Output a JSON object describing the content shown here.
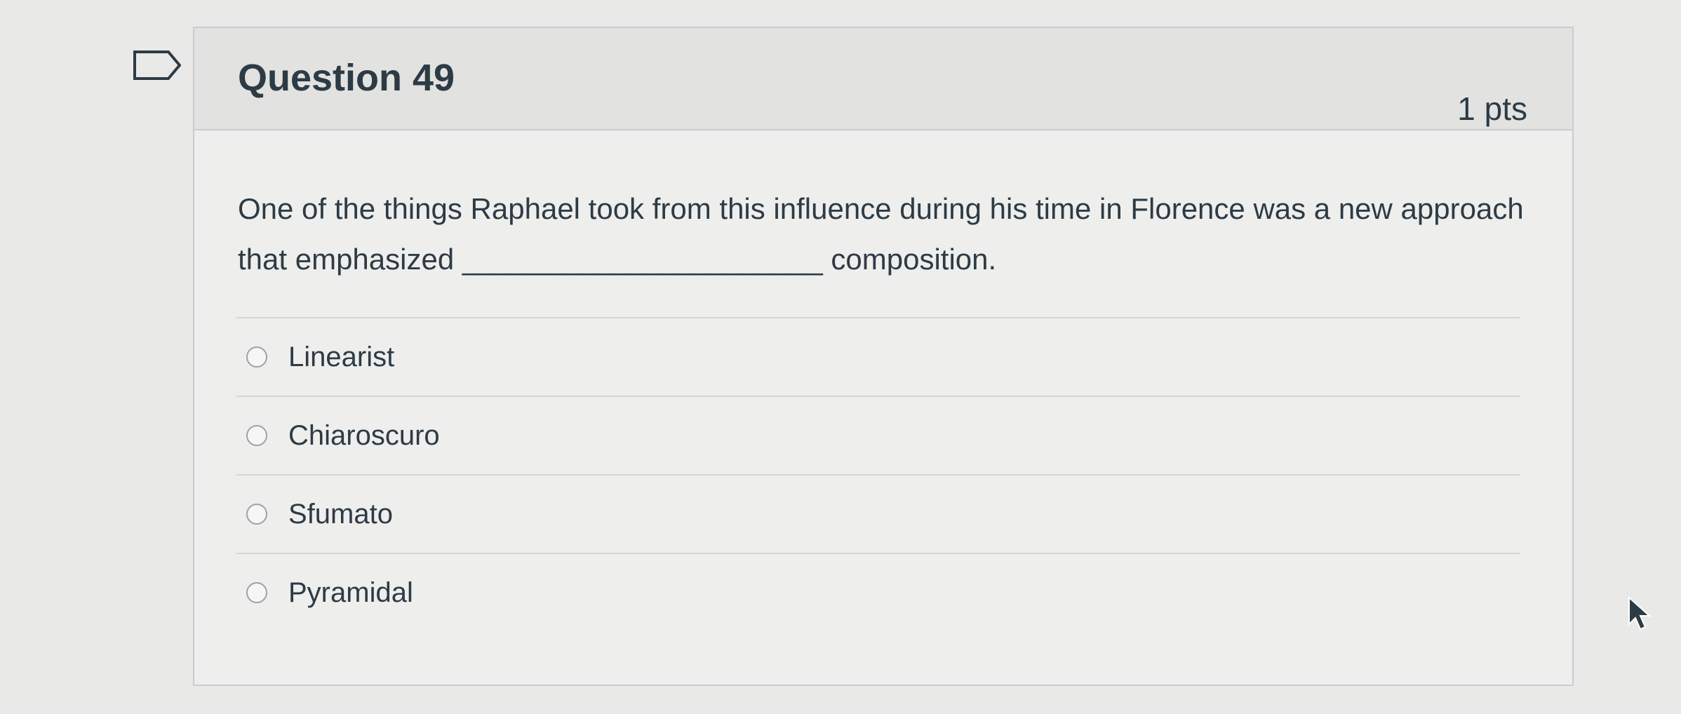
{
  "question": {
    "title": "Question 49",
    "points": "1 pts",
    "text": "One of the things Raphael took from this influence during his time in Florence was a new approach that emphasized ______________________ composition.",
    "answers": [
      {
        "label": "Linearist",
        "selected": false
      },
      {
        "label": "Chiaroscuro",
        "selected": false
      },
      {
        "label": "Sfumato",
        "selected": false
      },
      {
        "label": "Pyramidal",
        "selected": false
      }
    ]
  },
  "icons": {
    "bookmark": "bookmark-flag-icon",
    "cursor": "mouse-pointer-icon"
  },
  "colors": {
    "text": "#2d3b45",
    "border": "#c7cdd1",
    "header_bg": "#e2e2e0"
  }
}
